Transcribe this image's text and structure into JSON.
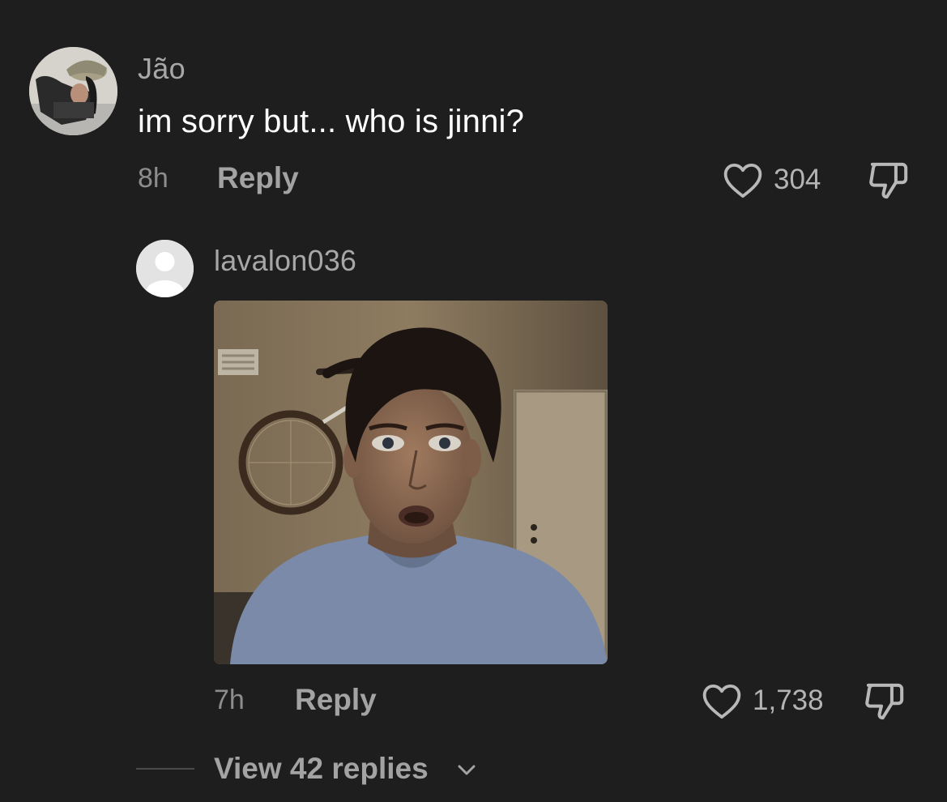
{
  "comment": {
    "author": "Jão",
    "text": "im sorry but... who is jinni?",
    "time": "8h",
    "reply_label": "Reply",
    "likes": "304",
    "avatar_icon": "user-avatar-photo",
    "like_icon": "heart-outline-icon",
    "dislike_icon": "thumbs-down-outline-icon"
  },
  "reply": {
    "author": "lavalon036",
    "time": "7h",
    "reply_label": "Reply",
    "likes": "1,738",
    "avatar_icon": "default-avatar-icon",
    "image": "reaction-photo"
  },
  "view_replies": {
    "label": "View 42 replies",
    "icon": "chevron-down-icon"
  },
  "colors": {
    "background": "#1e1e1e",
    "primary_text": "#ffffff",
    "secondary_text": "#a7a7a7",
    "muted_text": "#8d8d8d"
  }
}
